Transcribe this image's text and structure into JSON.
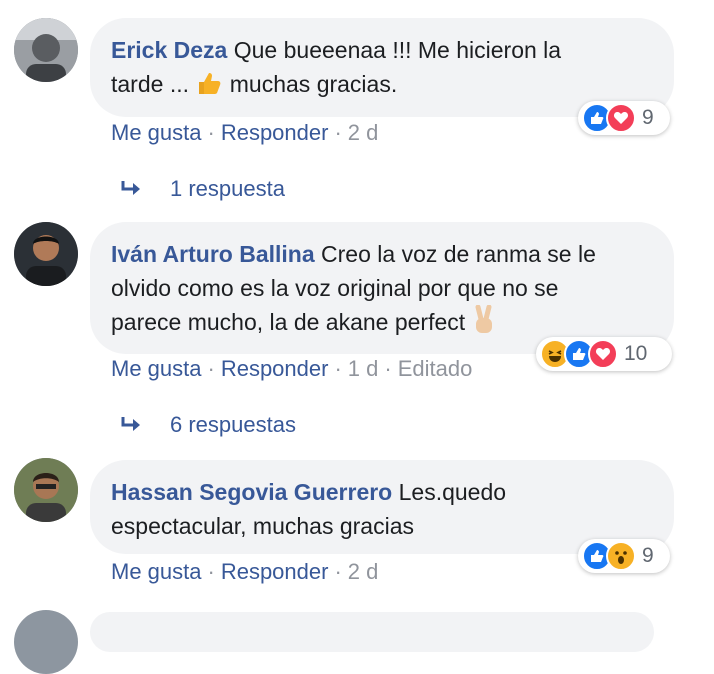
{
  "comments": [
    {
      "author": "Erick Deza",
      "text_line1": "Que bueeenaa !!! Me hicieron la",
      "text_line2a": "tarde ...",
      "text_line2b": "muchas gracias.",
      "reactions": [
        "like",
        "love"
      ],
      "reaction_count": "9",
      "actions": {
        "like": "Me gusta",
        "reply": "Responder",
        "time": "2 d"
      },
      "replies_label": "1 respuesta"
    },
    {
      "author": "Iván Arturo Ballina",
      "text_line1": "Creo la voz de ranma se le",
      "text_line2": "olvido como es la voz original por que no se",
      "text_line3": "parece mucho, la de akane perfect",
      "reactions": [
        "haha",
        "like",
        "love"
      ],
      "reaction_count": "10",
      "actions": {
        "like": "Me gusta",
        "reply": "Responder",
        "time": "1 d",
        "edited": "Editado"
      },
      "replies_label": "6 respuestas"
    },
    {
      "author": "Hassan Segovia Guerrero",
      "text_line1": "Les.quedo",
      "text_line2": "espectacular, muchas gracias",
      "reactions": [
        "like",
        "wow"
      ],
      "reaction_count": "9",
      "actions": {
        "like": "Me gusta",
        "reply": "Responder",
        "time": "2 d"
      }
    }
  ],
  "colors": {
    "link": "#385898",
    "muted": "#90949c",
    "bubble": "#f2f3f5",
    "like": "#1877f2",
    "love": "#f33e58",
    "haha": "#f7b125"
  },
  "icons": [
    "avatar",
    "like-icon",
    "love-icon",
    "haha-icon",
    "wow-icon",
    "thumbs-up-emoji",
    "victory-hand-emoji",
    "reply-arrow-icon"
  ]
}
